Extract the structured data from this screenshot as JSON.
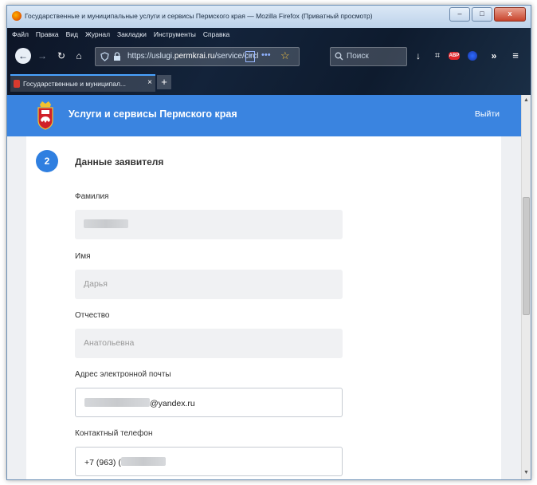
{
  "window": {
    "title": "Государственные и муниципальные услуги и сервисы Пермского края — Mozilla Firefox (Приватный просмотр)",
    "minimize": "–",
    "maximize": "□",
    "close": "x"
  },
  "menu": [
    "Файл",
    "Правка",
    "Вид",
    "Журнал",
    "Закладки",
    "Инструменты",
    "Справка"
  ],
  "toolbar": {
    "url_prefix": "https://uslugi.",
    "url_host": "permkrai.ru",
    "url_rest": "/service/circl",
    "search_placeholder": "Поиск"
  },
  "tab": {
    "label": "Государственные и муниципал...",
    "close": "×",
    "new": "+"
  },
  "header": {
    "site_title": "Услуги и сервисы Пермского края",
    "logout": "Выйти"
  },
  "form": {
    "step_number": "2",
    "section_title": "Данные заявителя",
    "fields": [
      {
        "label": "Фамилия",
        "value": ""
      },
      {
        "label": "Имя",
        "value": "Дарья"
      },
      {
        "label": "Отчество",
        "value": "Анатольевна"
      },
      {
        "label": "Адрес электронной почты",
        "value": "@yandex.ru"
      },
      {
        "label": "Контактный телефон",
        "value": "+7 (963) ("
      }
    ]
  },
  "colors": {
    "header": "#3a84e0",
    "step_badge": "#2f7fe0"
  }
}
